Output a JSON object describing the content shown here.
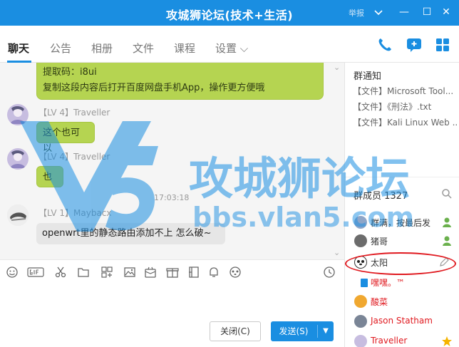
{
  "window": {
    "title": "攻城狮论坛(技术+生活)",
    "report_label": "举报",
    "minimize_glyph": "—",
    "maximize_glyph": "☐",
    "close_glyph": "✕"
  },
  "tabs": [
    {
      "label": "聊天"
    },
    {
      "label": "公告"
    },
    {
      "label": "相册"
    },
    {
      "label": "文件"
    },
    {
      "label": "课程"
    },
    {
      "label": "设置 ⌵"
    }
  ],
  "chat": {
    "messages": [
      {
        "line1": "提取码：i8ui",
        "line2": "复制这段内容后打开百度网盘手机App，操作更方便哦"
      },
      {
        "nick": "【LV 4】Traveller",
        "text": "这个也可以"
      },
      {
        "nick": "【LV 4】Traveller",
        "text": "也"
      },
      {
        "time": "17:03:18"
      },
      {
        "nick": "【LV 1】Maybacx",
        "text": "openwrt里的静态路由添加不上  怎么破~"
      }
    ]
  },
  "notice": {
    "title": "群通知",
    "files": [
      "【文件】Microsoft Tool...",
      "【文件】《刑法》.txt",
      "【文件】Kali Linux Web ..."
    ]
  },
  "members": {
    "title": "群成员 1327",
    "list": [
      {
        "name": "群满，按最后发",
        "color": "#333333"
      },
      {
        "name": "猪哥",
        "color": "#333333"
      },
      {
        "name": "太阳",
        "color": "#333333"
      },
      {
        "name": "嘿嘿。™",
        "color": "#e0191f"
      },
      {
        "name": "酸菜",
        "color": "#e0191f"
      },
      {
        "name": "Jason Statham",
        "color": "#e0191f"
      },
      {
        "name": "Traveller",
        "color": "#e0191f"
      }
    ]
  },
  "watermark": {
    "cn": "攻城狮论坛",
    "url": "bbs.vlan5.com",
    "logo": "V5"
  },
  "buttons": {
    "close": "关闭(C)",
    "send": "发送(S)"
  },
  "colors": {
    "brand": "#1a8ee1",
    "bubble_green": "#b5d451",
    "highlight_red": "#e0191f"
  }
}
